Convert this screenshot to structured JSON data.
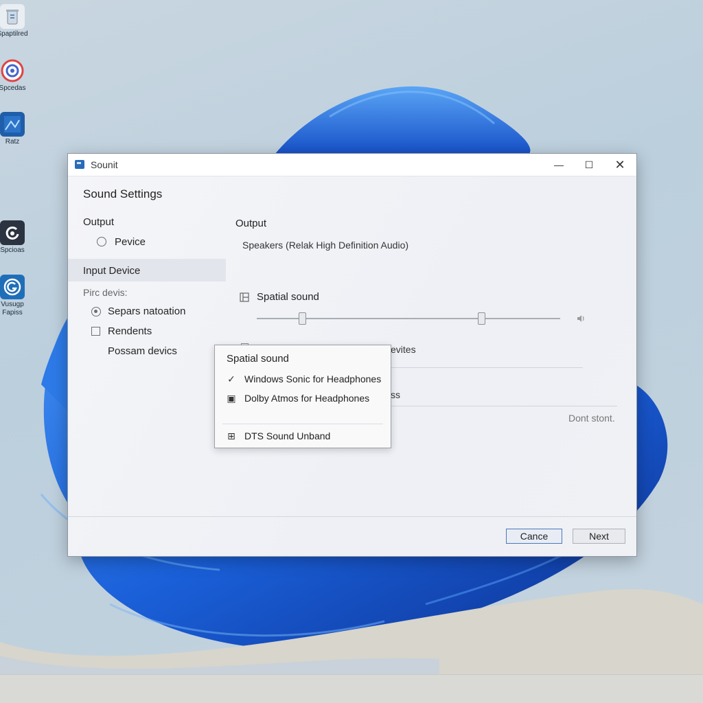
{
  "desktop": {
    "icons": [
      {
        "label": "Spaptilred",
        "icon": "recycle-bin-icon"
      },
      {
        "label": "Spcedas",
        "icon": "target-icon"
      },
      {
        "label": "Ratz",
        "icon": "image-app-icon"
      },
      {
        "label": "Spcioas",
        "icon": "refresh-app-icon"
      },
      {
        "label": "Vusugp Fapiss",
        "icon": "circle-app-icon"
      }
    ]
  },
  "window": {
    "title": "Sounit",
    "controls": {
      "minimize": "—",
      "maximize": "☐",
      "close": "✕"
    },
    "heading": "Sound Settings",
    "left": {
      "output_label": "Output",
      "device_option": "Pevice",
      "input_device": "Input Device",
      "pirc_devis": "Pirc devis:",
      "option_separation": "Separs natoation",
      "option_rendents": "Rendents",
      "possam_devices": "Possam devics"
    },
    "right": {
      "output_title": "Output",
      "output_device": "Speakers (Relak High Definition Audio)",
      "spatial_label": "Spatial sound",
      "slider_thumb1": 0.15,
      "slider_thumb2": 0.74,
      "partial_row1": "evites",
      "partial_row2": "ss",
      "dont_store": "Dont stont."
    },
    "footer": {
      "cancel": "Cance",
      "next": "Next"
    }
  },
  "popup": {
    "title": "Spatial sound",
    "items": [
      {
        "label": "Windows Sonic for Headphones",
        "icon": "✓",
        "checked": true
      },
      {
        "label": "Dolby Atmos for Headphones",
        "icon": "▣"
      },
      {
        "label": "DTS Sound Unband",
        "icon": "⊞"
      }
    ]
  }
}
